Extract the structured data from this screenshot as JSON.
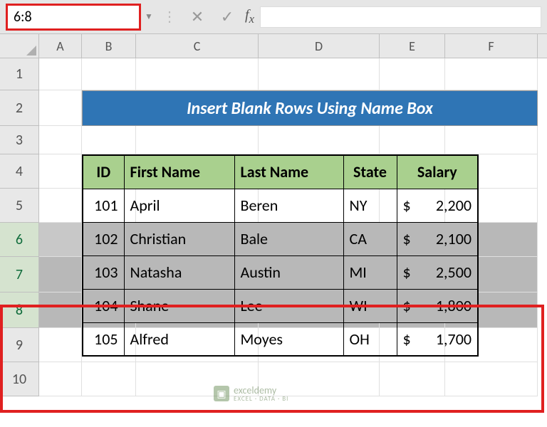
{
  "name_box": "6:8",
  "title": "Insert Blank Rows Using Name Box",
  "columns": [
    "A",
    "B",
    "C",
    "D",
    "E",
    "F"
  ],
  "row_numbers": [
    1,
    2,
    3,
    4,
    5,
    6,
    7,
    8,
    9,
    10
  ],
  "selected_rows": [
    6,
    7,
    8
  ],
  "headers": {
    "id": "ID",
    "first_name": "First Name",
    "last_name": "Last Name",
    "state": "State",
    "salary": "Salary"
  },
  "currency": "$",
  "rows": [
    {
      "id": "101",
      "first_name": "April",
      "last_name": "Beren",
      "state": "NY",
      "salary": "2,200",
      "selected": false
    },
    {
      "id": "102",
      "first_name": "Christian",
      "last_name": "Bale",
      "state": "CA",
      "salary": "2,100",
      "selected": true
    },
    {
      "id": "103",
      "first_name": "Natasha",
      "last_name": "Austin",
      "state": "MI",
      "salary": "2,500",
      "selected": true
    },
    {
      "id": "104",
      "first_name": "Shane",
      "last_name": "Lee",
      "state": "WI",
      "salary": "1,800",
      "selected": true
    },
    {
      "id": "105",
      "first_name": "Alfred",
      "last_name": "Moyes",
      "state": "OH",
      "salary": "1,700",
      "selected": false
    }
  ],
  "watermark": {
    "brand": "exceldemy",
    "tagline": "EXCEL · DATA · BI"
  },
  "chart_data": {
    "type": "table",
    "title": "Insert Blank Rows Using Name Box",
    "columns": [
      "ID",
      "First Name",
      "Last Name",
      "State",
      "Salary"
    ],
    "rows": [
      [
        101,
        "April",
        "Beren",
        "NY",
        2200
      ],
      [
        102,
        "Christian",
        "Bale",
        "CA",
        2100
      ],
      [
        103,
        "Natasha",
        "Austin",
        "MI",
        2500
      ],
      [
        104,
        "Shane",
        "Lee",
        "WI",
        1800
      ],
      [
        105,
        "Alfred",
        "Moyes",
        "OH",
        1700
      ]
    ]
  }
}
